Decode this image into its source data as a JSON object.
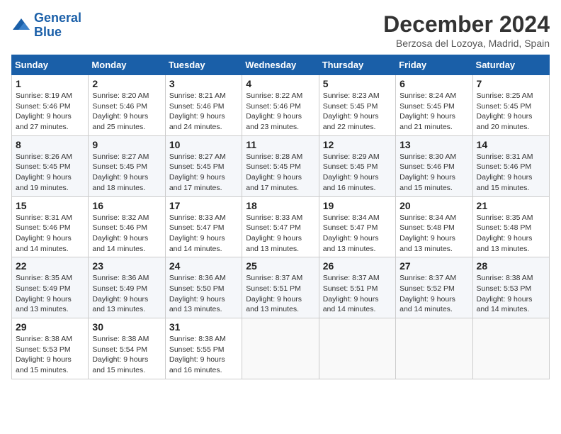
{
  "header": {
    "logo_line1": "General",
    "logo_line2": "Blue",
    "month": "December 2024",
    "location": "Berzosa del Lozoya, Madrid, Spain"
  },
  "weekdays": [
    "Sunday",
    "Monday",
    "Tuesday",
    "Wednesday",
    "Thursday",
    "Friday",
    "Saturday"
  ],
  "weeks": [
    [
      {
        "day": 1,
        "info": "Sunrise: 8:19 AM\nSunset: 5:46 PM\nDaylight: 9 hours and 27 minutes."
      },
      {
        "day": 2,
        "info": "Sunrise: 8:20 AM\nSunset: 5:46 PM\nDaylight: 9 hours and 25 minutes."
      },
      {
        "day": 3,
        "info": "Sunrise: 8:21 AM\nSunset: 5:46 PM\nDaylight: 9 hours and 24 minutes."
      },
      {
        "day": 4,
        "info": "Sunrise: 8:22 AM\nSunset: 5:46 PM\nDaylight: 9 hours and 23 minutes."
      },
      {
        "day": 5,
        "info": "Sunrise: 8:23 AM\nSunset: 5:45 PM\nDaylight: 9 hours and 22 minutes."
      },
      {
        "day": 6,
        "info": "Sunrise: 8:24 AM\nSunset: 5:45 PM\nDaylight: 9 hours and 21 minutes."
      },
      {
        "day": 7,
        "info": "Sunrise: 8:25 AM\nSunset: 5:45 PM\nDaylight: 9 hours and 20 minutes."
      }
    ],
    [
      {
        "day": 8,
        "info": "Sunrise: 8:26 AM\nSunset: 5:45 PM\nDaylight: 9 hours and 19 minutes."
      },
      {
        "day": 9,
        "info": "Sunrise: 8:27 AM\nSunset: 5:45 PM\nDaylight: 9 hours and 18 minutes."
      },
      {
        "day": 10,
        "info": "Sunrise: 8:27 AM\nSunset: 5:45 PM\nDaylight: 9 hours and 17 minutes."
      },
      {
        "day": 11,
        "info": "Sunrise: 8:28 AM\nSunset: 5:45 PM\nDaylight: 9 hours and 17 minutes."
      },
      {
        "day": 12,
        "info": "Sunrise: 8:29 AM\nSunset: 5:45 PM\nDaylight: 9 hours and 16 minutes."
      },
      {
        "day": 13,
        "info": "Sunrise: 8:30 AM\nSunset: 5:46 PM\nDaylight: 9 hours and 15 minutes."
      },
      {
        "day": 14,
        "info": "Sunrise: 8:31 AM\nSunset: 5:46 PM\nDaylight: 9 hours and 15 minutes."
      }
    ],
    [
      {
        "day": 15,
        "info": "Sunrise: 8:31 AM\nSunset: 5:46 PM\nDaylight: 9 hours and 14 minutes."
      },
      {
        "day": 16,
        "info": "Sunrise: 8:32 AM\nSunset: 5:46 PM\nDaylight: 9 hours and 14 minutes."
      },
      {
        "day": 17,
        "info": "Sunrise: 8:33 AM\nSunset: 5:47 PM\nDaylight: 9 hours and 14 minutes."
      },
      {
        "day": 18,
        "info": "Sunrise: 8:33 AM\nSunset: 5:47 PM\nDaylight: 9 hours and 13 minutes."
      },
      {
        "day": 19,
        "info": "Sunrise: 8:34 AM\nSunset: 5:47 PM\nDaylight: 9 hours and 13 minutes."
      },
      {
        "day": 20,
        "info": "Sunrise: 8:34 AM\nSunset: 5:48 PM\nDaylight: 9 hours and 13 minutes."
      },
      {
        "day": 21,
        "info": "Sunrise: 8:35 AM\nSunset: 5:48 PM\nDaylight: 9 hours and 13 minutes."
      }
    ],
    [
      {
        "day": 22,
        "info": "Sunrise: 8:35 AM\nSunset: 5:49 PM\nDaylight: 9 hours and 13 minutes."
      },
      {
        "day": 23,
        "info": "Sunrise: 8:36 AM\nSunset: 5:49 PM\nDaylight: 9 hours and 13 minutes."
      },
      {
        "day": 24,
        "info": "Sunrise: 8:36 AM\nSunset: 5:50 PM\nDaylight: 9 hours and 13 minutes."
      },
      {
        "day": 25,
        "info": "Sunrise: 8:37 AM\nSunset: 5:51 PM\nDaylight: 9 hours and 13 minutes."
      },
      {
        "day": 26,
        "info": "Sunrise: 8:37 AM\nSunset: 5:51 PM\nDaylight: 9 hours and 14 minutes."
      },
      {
        "day": 27,
        "info": "Sunrise: 8:37 AM\nSunset: 5:52 PM\nDaylight: 9 hours and 14 minutes."
      },
      {
        "day": 28,
        "info": "Sunrise: 8:38 AM\nSunset: 5:53 PM\nDaylight: 9 hours and 14 minutes."
      }
    ],
    [
      {
        "day": 29,
        "info": "Sunrise: 8:38 AM\nSunset: 5:53 PM\nDaylight: 9 hours and 15 minutes."
      },
      {
        "day": 30,
        "info": "Sunrise: 8:38 AM\nSunset: 5:54 PM\nDaylight: 9 hours and 15 minutes."
      },
      {
        "day": 31,
        "info": "Sunrise: 8:38 AM\nSunset: 5:55 PM\nDaylight: 9 hours and 16 minutes."
      },
      null,
      null,
      null,
      null
    ]
  ]
}
